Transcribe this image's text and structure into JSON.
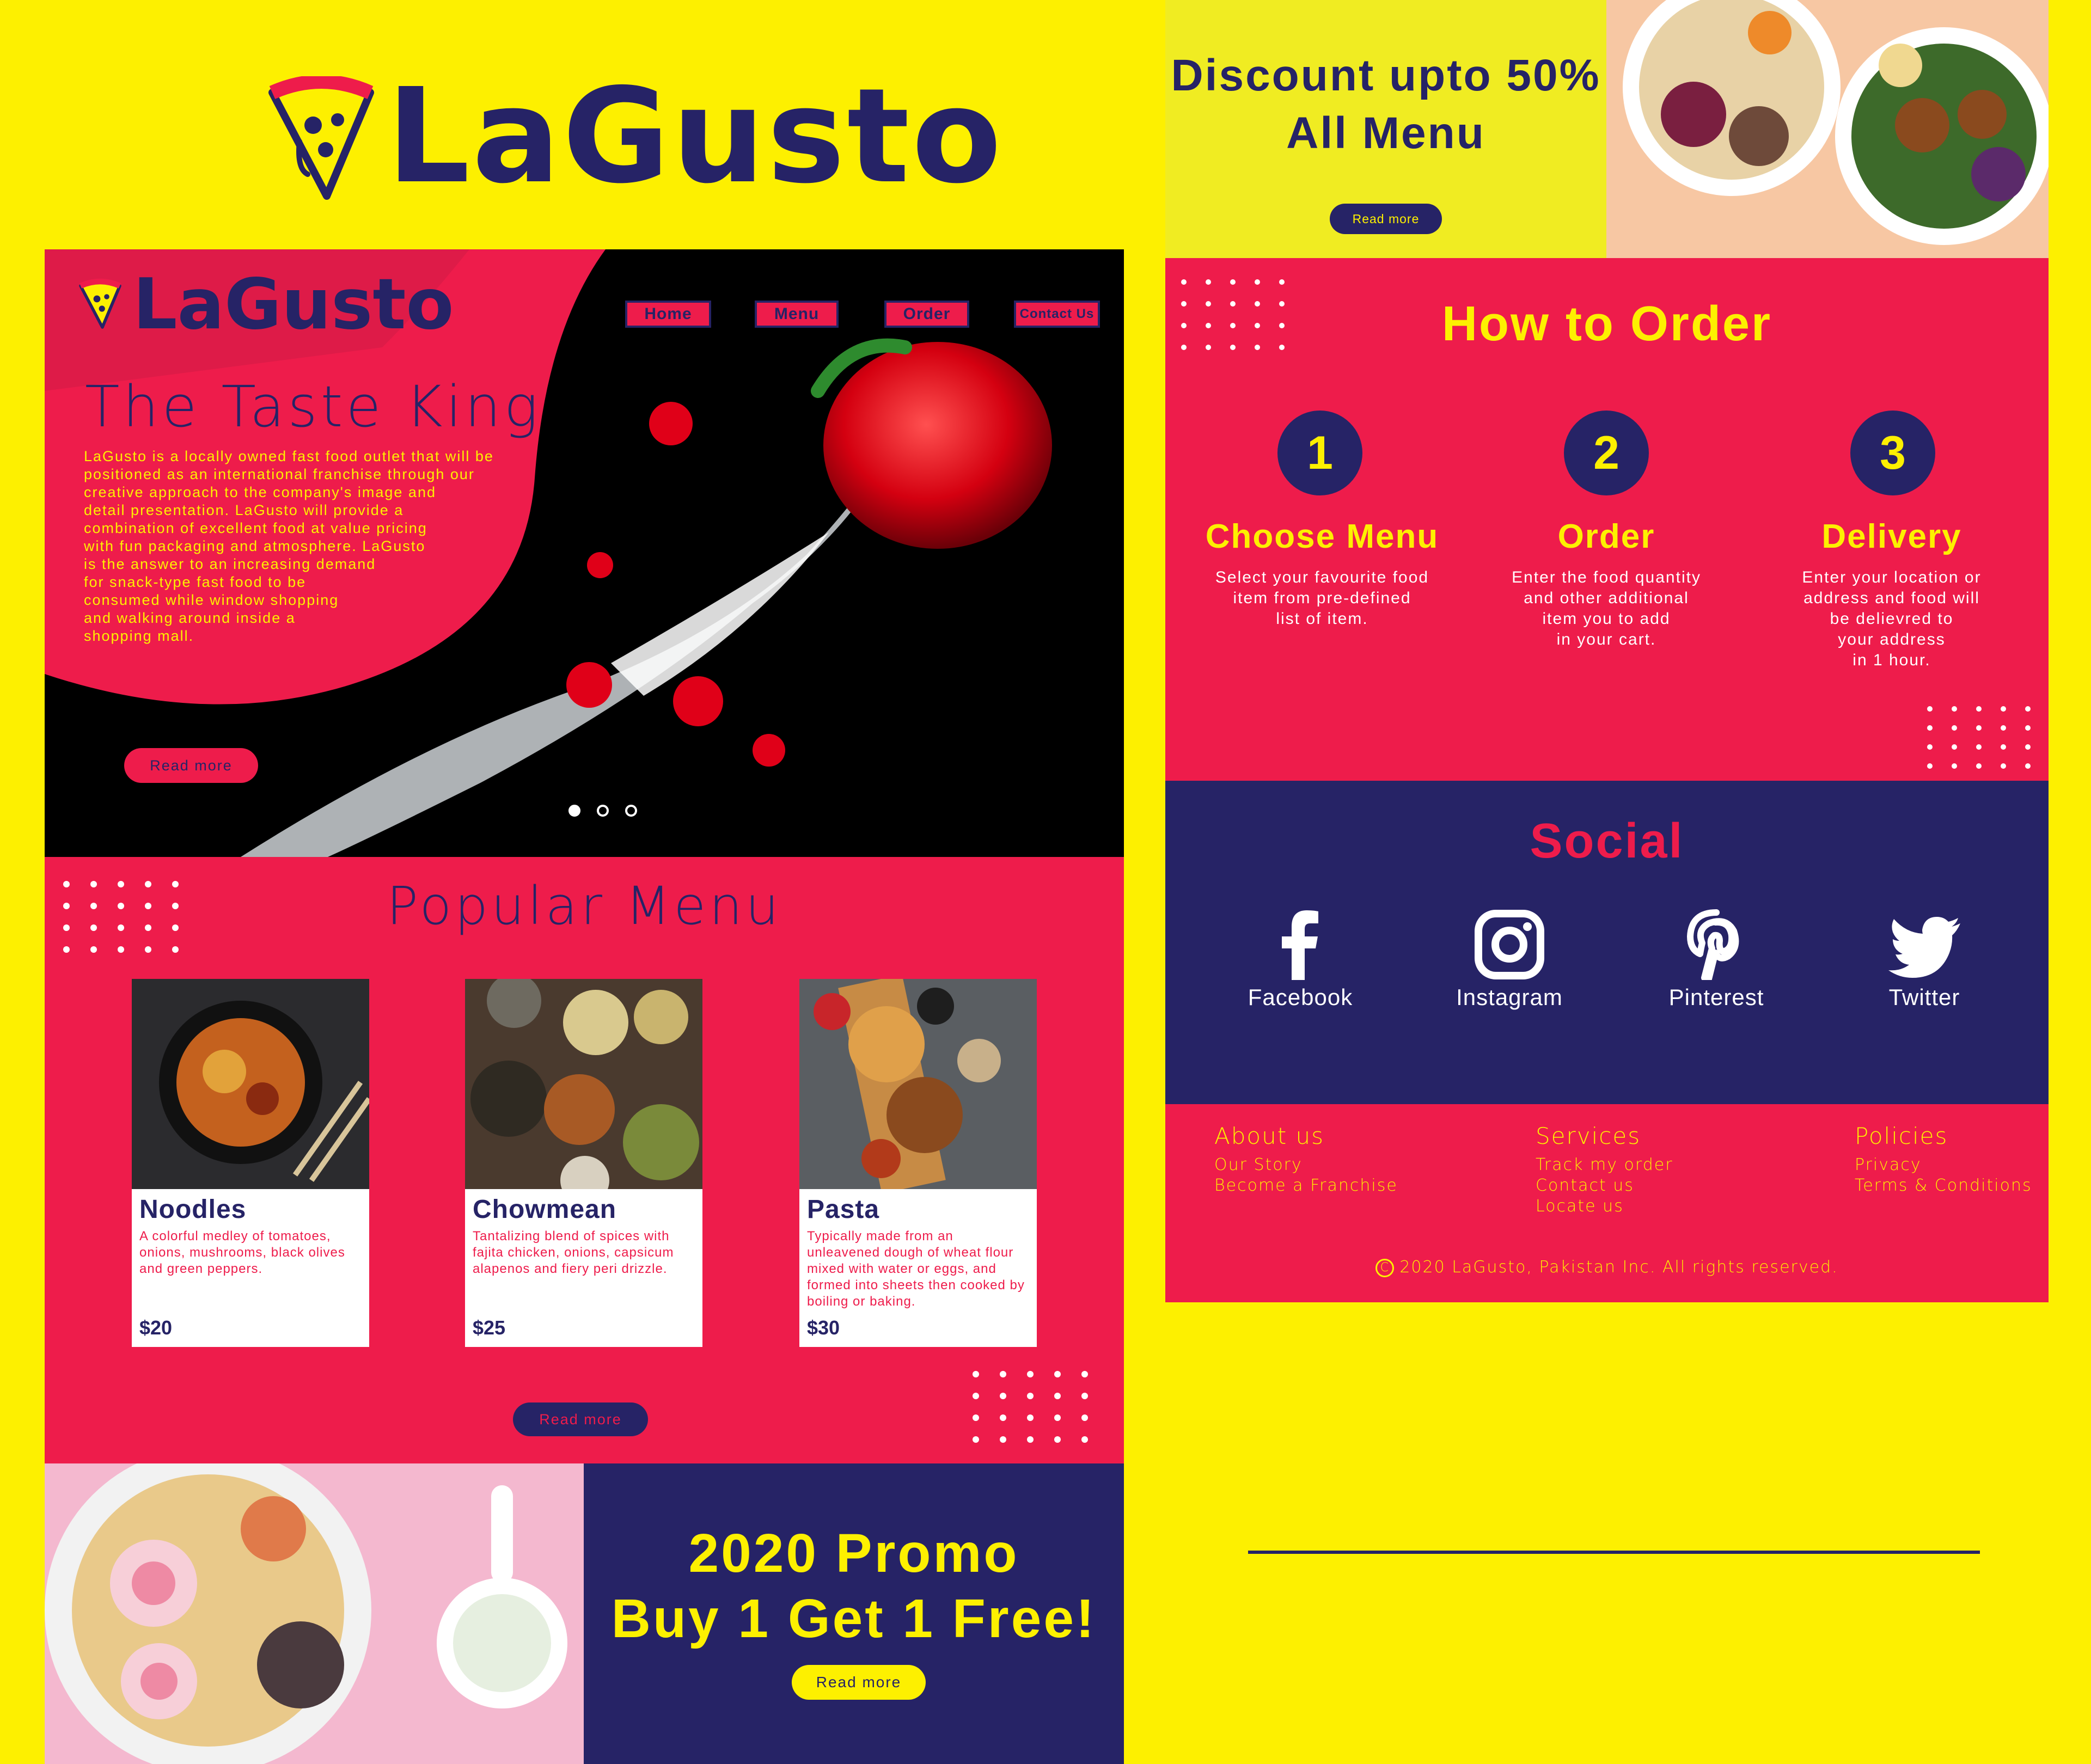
{
  "brand": {
    "name": "LaGusto"
  },
  "colors": {
    "yellow": "#fdf000",
    "pink": "#ee1c4b",
    "navy": "#262366"
  },
  "hero": {
    "logo": "LaGusto",
    "nav": [
      "Home",
      "Menu",
      "Order",
      "Contact Us"
    ],
    "title": "The Taste King",
    "text_lines": [
      "LaGusto is a locally owned fast food outlet that will be",
      "positioned as an international franchise through our",
      "creative approach to the company's image and",
      "detail presentation. LaGusto will provide a",
      "combination of excellent food at value pricing",
      "with fun packaging and atmosphere. LaGusto",
      "is the answer to an increasing demand",
      "for snack-type fast food to be",
      "consumed while window shopping",
      "and walking around inside a",
      "shopping mall."
    ],
    "read_more": "Read more"
  },
  "popular": {
    "title": "Popular Menu",
    "items": [
      {
        "name": "Noodles",
        "desc": "A colorful medley of tomatoes, onions, mushrooms, black olives and green peppers.",
        "price": "$20"
      },
      {
        "name": "Chowmean",
        "desc": "Tantalizing blend of spices with fajita chicken, onions, capsicum alapenos and fiery peri drizzle.",
        "price": "$25"
      },
      {
        "name": "Pasta",
        "desc": "Typically made from an unleavened dough of wheat flour mixed with water or eggs, and formed into sheets then cooked by boiling or baking.",
        "price": "$30"
      }
    ],
    "read_more": "Read more"
  },
  "promo": {
    "line1": "2020 Promo",
    "line2": "Buy 1 Get 1 Free!",
    "read_more": "Read more"
  },
  "discount": {
    "line1": "Discount upto 50%",
    "line2": "All Menu",
    "read_more": "Read more"
  },
  "how": {
    "title": "How to Order",
    "steps": [
      {
        "num": "1",
        "title": "Choose Menu",
        "lines": [
          "Select your favourite food",
          "item from pre-defined",
          "list of item."
        ]
      },
      {
        "num": "2",
        "title": "Order",
        "lines": [
          "Enter the food quantity",
          "and other additional",
          "item you to add",
          "in your cart."
        ]
      },
      {
        "num": "3",
        "title": "Delivery",
        "lines": [
          "Enter your location or",
          "address and food will",
          "be delievred to",
          "your address",
          "in 1 hour."
        ]
      }
    ]
  },
  "social": {
    "title": "Social",
    "items": [
      {
        "label": "Facebook",
        "icon": "facebook-icon"
      },
      {
        "label": "Instagram",
        "icon": "instagram-icon"
      },
      {
        "label": "Pinterest",
        "icon": "pinterest-icon"
      },
      {
        "label": "Twitter",
        "icon": "twitter-icon"
      }
    ]
  },
  "footer": {
    "cols": [
      {
        "head": "About us",
        "links": [
          "Our Story",
          "Become a Franchise"
        ]
      },
      {
        "head": "Services",
        "links": [
          "Track my order",
          "Contact us",
          "Locate us"
        ]
      },
      {
        "head": "Policies",
        "links": [
          "Privacy",
          "Terms & Conditions"
        ]
      }
    ],
    "copyright": "2020 LaGusto, Pakistan Inc. All rights reserved."
  }
}
